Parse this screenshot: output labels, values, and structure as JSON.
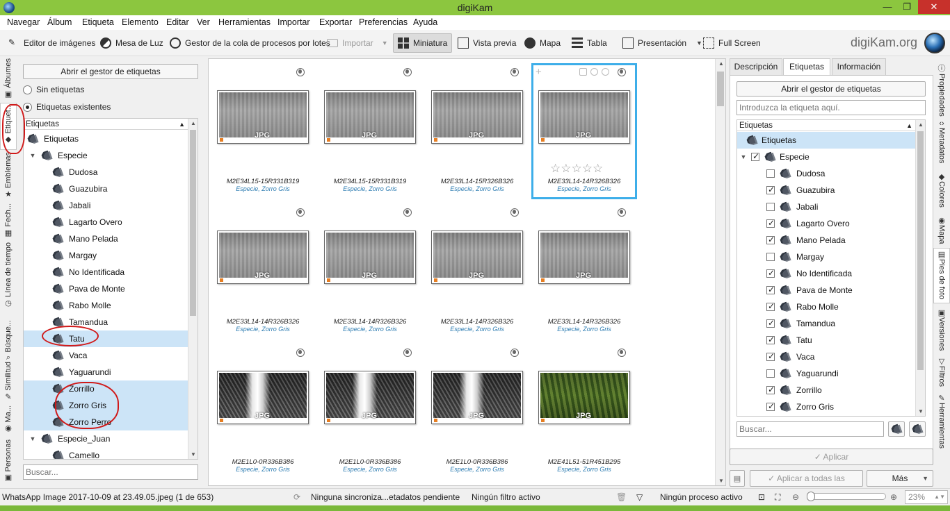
{
  "window": {
    "title": "digiKam",
    "min": "—",
    "max": "❐",
    "close": "✕"
  },
  "menu": [
    "Navegar",
    "Álbum",
    "Etiqueta",
    "Elemento",
    "Editar",
    "Ver",
    "Herramientas",
    "Importar",
    "Exportar",
    "Preferencias",
    "Ayuda"
  ],
  "toolbar": {
    "image_editor": "Editor de imágenes",
    "light_table": "Mesa de Luz",
    "queue_manager": "Gestor de la cola de procesos por lotes",
    "import": "Importar",
    "thumbnail": "Miniatura",
    "preview": "Vista previa",
    "map": "Mapa",
    "table": "Tabla",
    "slideshow": "Presentación",
    "fullscreen": "Full Screen",
    "brand": "digiKam.org"
  },
  "left_tabs": [
    "Álbumes",
    "Etiquet...",
    "Emblemas",
    "Fech...",
    "Línea de tiempo",
    "Búsque...",
    "Similitud",
    "Ma...",
    "Personas"
  ],
  "left": {
    "open_manager": "Abrir el gestor de etiquetas",
    "radio_none": "Sin etiquetas",
    "radio_existing": "Etiquetas existentes",
    "tree_header": "Etiquetas",
    "tree": [
      {
        "label": "Etiquetas",
        "level": 0,
        "selected": false,
        "caret": ""
      },
      {
        "label": "Especie",
        "level": 1,
        "selected": false,
        "caret": "▼"
      },
      {
        "label": "Dudosa",
        "level": 2,
        "selected": false
      },
      {
        "label": "Guazubira",
        "level": 2,
        "selected": false
      },
      {
        "label": "Jabali",
        "level": 2,
        "selected": false
      },
      {
        "label": "Lagarto Overo",
        "level": 2,
        "selected": false
      },
      {
        "label": "Mano Pelada",
        "level": 2,
        "selected": false
      },
      {
        "label": "Margay",
        "level": 2,
        "selected": false
      },
      {
        "label": "No Identificada",
        "level": 2,
        "selected": false
      },
      {
        "label": "Pava de Monte",
        "level": 2,
        "selected": false
      },
      {
        "label": "Rabo Molle",
        "level": 2,
        "selected": false
      },
      {
        "label": "Tamandua",
        "level": 2,
        "selected": false
      },
      {
        "label": "Tatu",
        "level": 2,
        "selected": true
      },
      {
        "label": "Vaca",
        "level": 2,
        "selected": false
      },
      {
        "label": "Yaguarundi",
        "level": 2,
        "selected": false
      },
      {
        "label": "Zorrillo",
        "level": 2,
        "selected": true
      },
      {
        "label": "Zorro Gris",
        "level": 2,
        "selected": true
      },
      {
        "label": "Zorro Perro",
        "level": 2,
        "selected": true
      },
      {
        "label": "Especie_Juan",
        "level": 1,
        "selected": false,
        "caret": "▼"
      },
      {
        "label": "Camello",
        "level": 2,
        "selected": false
      }
    ],
    "search_placeholder": "Buscar..."
  },
  "grid": {
    "items": [
      {
        "name": "M2E34L15-15R331B319",
        "tags": "Especie, Zorro Gris",
        "photo": "day",
        "selected": false
      },
      {
        "name": "M2E34L15-15R331B319",
        "tags": "Especie, Zorro Gris",
        "photo": "day",
        "selected": false
      },
      {
        "name": "M2E33L14-15R326B326",
        "tags": "Especie, Zorro Gris",
        "photo": "day",
        "selected": false
      },
      {
        "name": "M2E33L14-14R326B326",
        "tags": "Especie, Zorro Gris",
        "photo": "day",
        "selected": true
      },
      {
        "name": "M2E33L14-14R326B326",
        "tags": "Especie, Zorro Gris",
        "photo": "day",
        "selected": false
      },
      {
        "name": "M2E33L14-14R326B326",
        "tags": "Especie, Zorro Gris",
        "photo": "day",
        "selected": false
      },
      {
        "name": "M2E33L14-14R326B326",
        "tags": "Especie, Zorro Gris",
        "photo": "day",
        "selected": false
      },
      {
        "name": "M2E33L14-14R326B326",
        "tags": "Especie, Zorro Gris",
        "photo": "day",
        "selected": false
      },
      {
        "name": "M2E1L0-0R336B386",
        "tags": "Especie, Zorro Gris",
        "photo": "night",
        "selected": false
      },
      {
        "name": "M2E1L0-0R336B386",
        "tags": "Especie, Zorro Gris",
        "photo": "night",
        "selected": false
      },
      {
        "name": "M2E1L0-0R336B386",
        "tags": "Especie, Zorro Gris",
        "photo": "night",
        "selected": false
      },
      {
        "name": "M2E41L51-51R451B295",
        "tags": "Especie, Zorro Gris",
        "photo": "color",
        "selected": false
      }
    ],
    "badge": "JPG",
    "stars": "☆☆☆☆☆"
  },
  "right": {
    "tabs": [
      "Descripción",
      "Etiquetas",
      "Información"
    ],
    "open_manager": "Abrir el gestor de etiquetas",
    "input_placeholder": "Introduzca la etiqueta aquí.",
    "tree_header": "Etiquetas",
    "root": "Etiquetas",
    "parent": "Especie",
    "items": [
      {
        "label": "Dudosa",
        "checked": false
      },
      {
        "label": "Guazubira",
        "checked": true
      },
      {
        "label": "Jabali",
        "checked": false
      },
      {
        "label": "Lagarto Overo",
        "checked": true
      },
      {
        "label": "Mano Pelada",
        "checked": true
      },
      {
        "label": "Margay",
        "checked": false
      },
      {
        "label": "No Identificada",
        "checked": true
      },
      {
        "label": "Pava de Monte",
        "checked": true
      },
      {
        "label": "Rabo Molle",
        "checked": true
      },
      {
        "label": "Tamandua",
        "checked": true
      },
      {
        "label": "Tatu",
        "checked": true
      },
      {
        "label": "Vaca",
        "checked": true
      },
      {
        "label": "Yaguarundi",
        "checked": false
      },
      {
        "label": "Zorrillo",
        "checked": true
      },
      {
        "label": "Zorro Gris",
        "checked": true
      }
    ],
    "search_placeholder": "Buscar...",
    "apply": "✓ Aplicar",
    "apply_all": "✓ Aplicar a todas las versiones",
    "more": "Más"
  },
  "right_tabs": [
    "Propiedades",
    "Metadatos",
    "Colores",
    "Mapa",
    "Pies de foto",
    "Versiones",
    "Filtros",
    "Herramientas"
  ],
  "status": {
    "file": "WhatsApp Image 2017-10-09 at 23.49.05.jpeg (1 de 653)",
    "sync": "Ninguna sincroniza...etadatos pendiente",
    "filter": "Ningún filtro activo",
    "process": "Ningún proceso activo",
    "zoom": "23%"
  },
  "colors": {
    "titlebar": "#8cc63f",
    "selection": "#cce4f7",
    "accent": "#3daee9",
    "caption_blue": "#2a7ab0",
    "annotation_red": "#d01919"
  }
}
